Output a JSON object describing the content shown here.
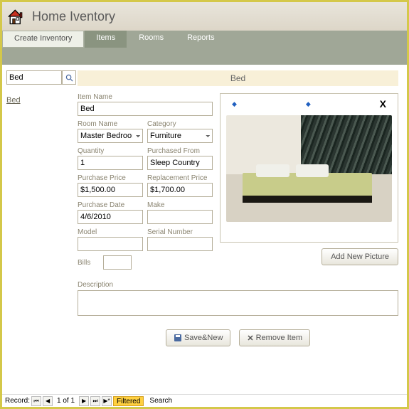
{
  "app": {
    "title": "Home Iventory"
  },
  "tabs": {
    "create": "Create Inventory",
    "items": "Items",
    "rooms": "Rooms",
    "reports": "Reports"
  },
  "search": {
    "value": "Bed",
    "icon": "search-icon"
  },
  "sidelinks": {
    "item0": "Bed"
  },
  "item": {
    "title": "Bed",
    "labels": {
      "name": "Item Name",
      "room": "Room Name",
      "category": "Category",
      "qty": "Quantity",
      "purchased_from": "Purchased From",
      "pprice": "Purchase Price",
      "rprice": "Replacement Price",
      "pdate": "Purchase Date",
      "make": "Make",
      "model": "Model",
      "serial": "Serial Number",
      "bills": "Bills",
      "description": "Description"
    },
    "values": {
      "name": "Bed",
      "room": "Master Bedroom",
      "category": "Furniture",
      "qty": "1",
      "purchased_from": "Sleep Country",
      "pprice": "$1,500.00",
      "rprice": "$1,700.00",
      "pdate": "4/6/2010",
      "make": "",
      "model": "",
      "serial": ""
    }
  },
  "image_panel": {
    "add_btn": "Add New Picture",
    "close": "X"
  },
  "actions": {
    "save_new": "Save&New",
    "remove": "Remove Item"
  },
  "footer": {
    "record_label": "Record:",
    "pos": "1 of 1",
    "filtered": "Filtered",
    "search": "Search",
    "nav": {
      "first": "⏮",
      "prev": "◀",
      "next": "▶",
      "last": "⏭",
      "new": "▶*"
    }
  }
}
